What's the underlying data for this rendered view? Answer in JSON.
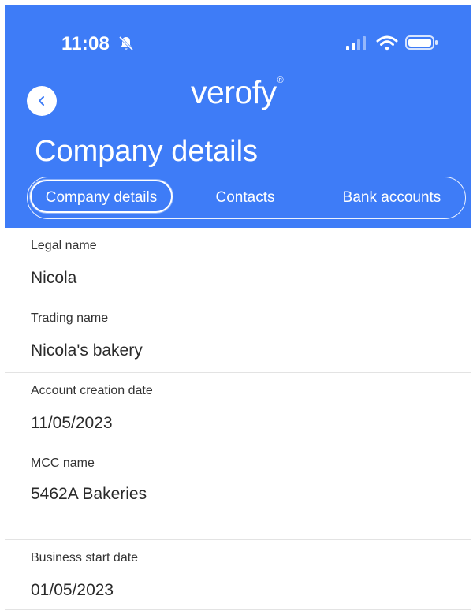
{
  "status_bar": {
    "time": "11:08",
    "icons": [
      "bell-slash-icon",
      "signal-icon",
      "wifi-icon",
      "battery-icon"
    ]
  },
  "header": {
    "logo": "verofy",
    "logo_mark": "®",
    "title": "Company details",
    "back_icon": "chevron-left-icon",
    "background_color": "#3e7cf7"
  },
  "tabs": [
    {
      "label": "Company details",
      "active": true
    },
    {
      "label": "Contacts",
      "active": false
    },
    {
      "label": "Bank accounts",
      "active": false
    }
  ],
  "fields": [
    {
      "label": "Legal name",
      "value": "Nicola"
    },
    {
      "label": "Trading name",
      "value": "Nicola's bakery"
    },
    {
      "label": "Account creation date",
      "value": "11/05/2023"
    },
    {
      "label": "MCC name",
      "value": "5462A Bakeries"
    },
    {
      "label": "Business start date",
      "value": "01/05/2023"
    }
  ]
}
